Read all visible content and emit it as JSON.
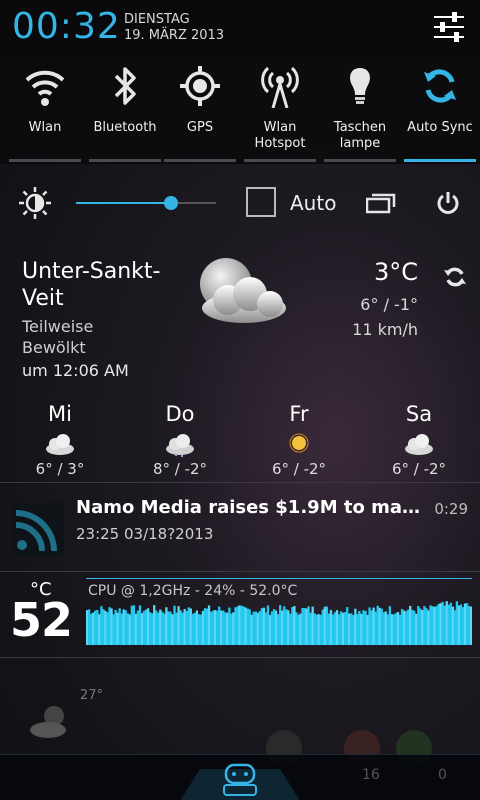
{
  "header": {
    "clock": "00:32",
    "weekday": "DIENSTAG",
    "date": "19. MÄRZ 2013"
  },
  "toggles": [
    {
      "label": "Wlan",
      "icon": "wifi-icon",
      "on": false
    },
    {
      "label": "Bluetooth",
      "icon": "bluetooth-icon",
      "on": false
    },
    {
      "label": "GPS",
      "icon": "gps-icon",
      "on": false
    },
    {
      "label": "Wlan Hotspot",
      "icon": "hotspot-icon",
      "on": false
    },
    {
      "label": "Taschen lampe",
      "icon": "flashlight-icon",
      "on": false
    },
    {
      "label": "Auto Sync",
      "icon": "sync-icon",
      "on": true
    }
  ],
  "brightness": {
    "level": 0.68,
    "auto_label": "Auto",
    "auto_checked": false
  },
  "weather": {
    "city_line1": "Unter-Sankt-",
    "city_line2": "Veit",
    "condition_line1": "Teilweise",
    "condition_line2": "Bewölkt",
    "updated": "um 12:06 AM",
    "temp": "3°C",
    "range": "6° / -1°",
    "wind": "11 km/h",
    "forecast": [
      {
        "day": "Mi",
        "range": "6° / 3°",
        "icon": "cloud-icon"
      },
      {
        "day": "Do",
        "range": "8° / -2°",
        "icon": "cloud-icon"
      },
      {
        "day": "Fr",
        "range": "6° / -2°",
        "icon": "sun-icon"
      },
      {
        "day": "Sa",
        "range": "6° / -2°",
        "icon": "cloud-icon"
      }
    ]
  },
  "notifications": {
    "news": {
      "title": "Namo Media raises $1.9M to mak..",
      "time": "0:29",
      "subtitle": "23:25 03/18?2013"
    },
    "cpu": {
      "unit": "°C",
      "temp": "52",
      "info": "CPU @ 1,2GHz - 24% - 52.0°C"
    }
  },
  "background": {
    "temp": "27°",
    "count_left": "16",
    "count_right": "0"
  },
  "colors": {
    "accent": "#35b5e5"
  }
}
